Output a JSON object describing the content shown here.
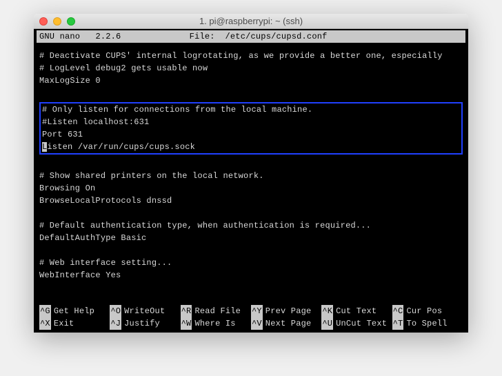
{
  "window": {
    "title": "1. pi@raspberrypi: ~ (ssh)"
  },
  "nano": {
    "app": "GNU nano",
    "version": "2.2.6",
    "file_label": "File:",
    "file_path": "/etc/cups/cupsd.conf"
  },
  "lines": {
    "l1": "# Deactivate CUPS' internal logrotating, as we provide a better one, especially",
    "l2": "# LogLevel debug2 gets usable now",
    "l3": "MaxLogSize 0",
    "l4": "",
    "h1": "# Only listen for connections from the local machine.",
    "h2": "#Listen localhost:631",
    "h3": "Port 631",
    "h4a": "L",
    "h4b": "isten /var/run/cups/cups.sock",
    "l5": "",
    "l6": "# Show shared printers on the local network.",
    "l7": "Browsing On",
    "l8": "BrowseLocalProtocols dnssd",
    "l9": "",
    "l10": "# Default authentication type, when authentication is required...",
    "l11": "DefaultAuthType Basic",
    "l12": "",
    "l13": "# Web interface setting...",
    "l14": "WebInterface Yes",
    "l15": ""
  },
  "commands": {
    "r1": [
      {
        "key": "^G",
        "label": "Get Help"
      },
      {
        "key": "^O",
        "label": "WriteOut"
      },
      {
        "key": "^R",
        "label": "Read File"
      },
      {
        "key": "^Y",
        "label": "Prev Page"
      },
      {
        "key": "^K",
        "label": "Cut Text"
      },
      {
        "key": "^C",
        "label": "Cur Pos"
      }
    ],
    "r2": [
      {
        "key": "^X",
        "label": "Exit"
      },
      {
        "key": "^J",
        "label": "Justify"
      },
      {
        "key": "^W",
        "label": "Where Is"
      },
      {
        "key": "^V",
        "label": "Next Page"
      },
      {
        "key": "^U",
        "label": "UnCut Text"
      },
      {
        "key": "^T",
        "label": "To Spell"
      }
    ]
  }
}
